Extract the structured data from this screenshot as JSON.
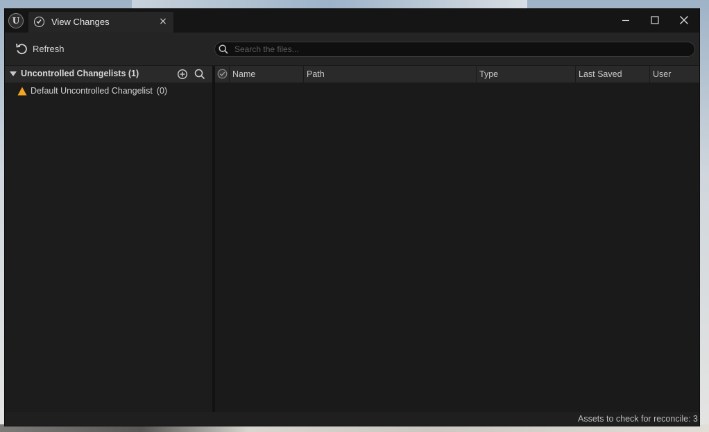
{
  "app": {
    "logo_text": "U"
  },
  "tab": {
    "title": "View Changes",
    "close_glyph": "×"
  },
  "toolbar": {
    "refresh_label": "Refresh",
    "search_placeholder": "Search the files..."
  },
  "left_panel": {
    "header_label": "Uncontrolled Changelists (1)",
    "changelists": [
      {
        "label": "Default Uncontrolled Changelist",
        "count": "(0)"
      }
    ]
  },
  "file_list": {
    "columns": [
      "Name",
      "Path",
      "Type",
      "Last Saved",
      "User"
    ],
    "rows": []
  },
  "status": {
    "text": "Assets to check for reconcile: 3"
  },
  "colors": {
    "window_bg": "#1a1a1a",
    "panel_header": "#2a2a2a",
    "warning": "#f5a623"
  },
  "icons": {
    "app": "unreal-logo-icon",
    "tab": "check-circle-icon",
    "refresh": "refresh-icon",
    "search": "search-icon",
    "add": "add-circle-icon",
    "warning": "warning-triangle-icon"
  }
}
